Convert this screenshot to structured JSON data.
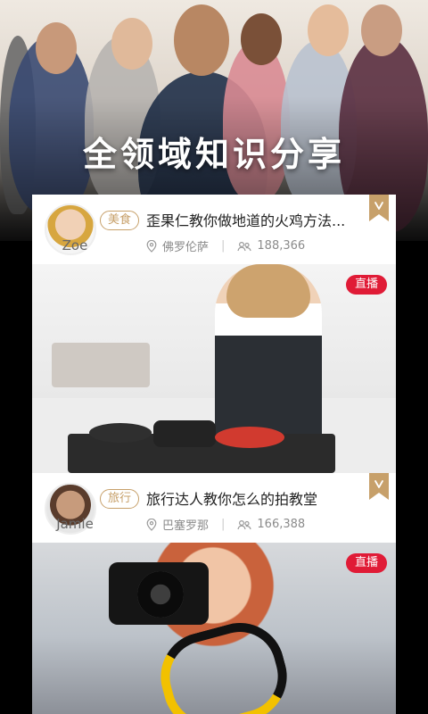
{
  "hero": {
    "title": "全领域知识分享"
  },
  "cards": [
    {
      "tag": "美食",
      "title": "歪果仁教你做地道的火鸡方法...",
      "username": "Zoe",
      "location": "佛罗伦萨",
      "viewers": "188,366",
      "live_label": "直播"
    },
    {
      "tag": "旅行",
      "title": "旅行达人教你怎么的拍教堂",
      "username": "Jamie",
      "location": "巴塞罗那",
      "viewers": "166,388",
      "live_label": "直播"
    }
  ],
  "colors": {
    "tag_gold": "#c7a06a",
    "live_red": "#e01b36",
    "meta_gray": "#8b8b8b"
  },
  "icons": {
    "location": "location-pin-icon",
    "viewers": "people-icon",
    "ribbon": "bookmark-ribbon-icon"
  }
}
